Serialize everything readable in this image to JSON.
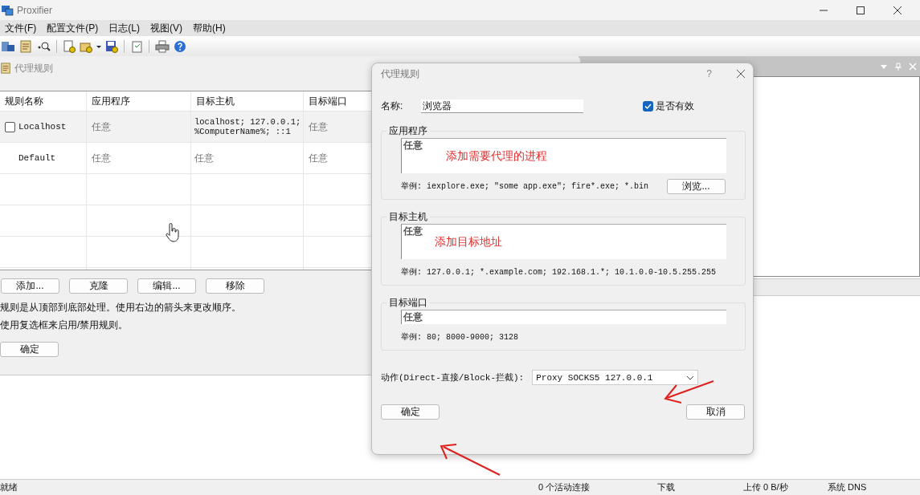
{
  "window": {
    "title": "Proxifier"
  },
  "menu": [
    {
      "label": "文件(F)"
    },
    {
      "label": "配置文件(P)"
    },
    {
      "label": "日志(L)"
    },
    {
      "label": "视图(V)"
    },
    {
      "label": "帮助(H)"
    }
  ],
  "rules_window": {
    "title": "代理规则",
    "columns": [
      "规则名称",
      "应用程序",
      "目标主机",
      "目标端口"
    ],
    "rows": [
      {
        "kind": "rule",
        "checked": false,
        "name": "Localhost",
        "application": "任意",
        "target_hosts": [
          "localhost; 127.0.0.1;",
          "%ComputerName%; ::1"
        ],
        "target_ports": "任意"
      },
      {
        "kind": "default",
        "name": "Default",
        "application": "任意",
        "target_hosts": [
          "任意"
        ],
        "target_ports": "任意"
      }
    ],
    "buttons": [
      "添加...",
      "克隆",
      "编辑...",
      "移除"
    ],
    "notes": [
      "规则是从顶部到底部处理。使用右边的箭头来更改顺序。",
      "使用复选框来启用/禁用规则。"
    ],
    "ok_button": "确定"
  },
  "dialog": {
    "title": "代理规则",
    "help": "?",
    "name_label": "名称:",
    "name_value": "浏览器",
    "enabled": {
      "label": "是否有效",
      "checked": true
    },
    "sections": [
      {
        "kind": "multiline",
        "title": "应用程序",
        "value": "任意",
        "annotation": "添加需要代理的进程",
        "example": "举例: iexplore.exe; \"some app.exe\"; fire*.exe; *.bin",
        "button": "浏览..."
      },
      {
        "kind": "multiline",
        "title": "目标主机",
        "value": "任意",
        "annotation": "添加目标地址",
        "example": "举例: 127.0.0.1; *.example.com; 192.168.1.*; 10.1.0.0-10.5.255.255"
      },
      {
        "kind": "single",
        "title": "目标端口",
        "value": "任意",
        "example": "举例: 80; 8000-9000; 3128"
      }
    ],
    "action_label": "动作(Direct-直接/Block-拦截):",
    "action_value": "Proxy SOCKS5 127.0.0.1",
    "ok_button": "确定",
    "cancel_button": "取消"
  },
  "status_bar": [
    "就绪",
    "0 个活动连接",
    "下载",
    "上传 0 B/秒",
    "系统 DNS"
  ]
}
